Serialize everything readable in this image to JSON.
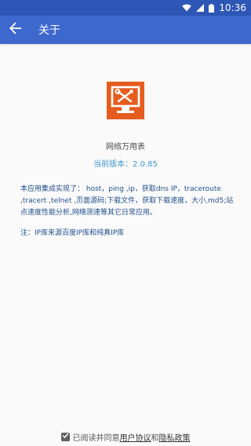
{
  "status_bar": {
    "time": "10:36",
    "icons": [
      "wifi-icon",
      "signal-icon",
      "battery-icon"
    ]
  },
  "app_bar": {
    "back_icon": "arrow-back-icon",
    "title": "关于"
  },
  "about": {
    "app_icon": "tools-monitor-icon",
    "app_name": "网络万用表",
    "version_label": "当前版本：",
    "version_value": "2.0.85",
    "description": "本应用集成实现了：  host，ping ,ip，获取dns IP，traceroute ,tracert ,telnet ,页面源码;下载文件，获取下载速度，大小,md5;站点速度性能分析,网络测速等其它日常应用。",
    "note": "注：IP库来源百度IP库和纯真IP库"
  },
  "footer": {
    "checkbox_checked": true,
    "agree_text": "已阅读并同意",
    "user_agreement": "用户协议",
    "and_text": "和",
    "privacy_policy": "隐私政策"
  },
  "colors": {
    "status_bar": "#2e56b6",
    "app_bar": "#3d68cd",
    "icon_bg": "#e55c1e",
    "version": "#3f96cc",
    "text_dark_blue": "#1f4f8a"
  }
}
